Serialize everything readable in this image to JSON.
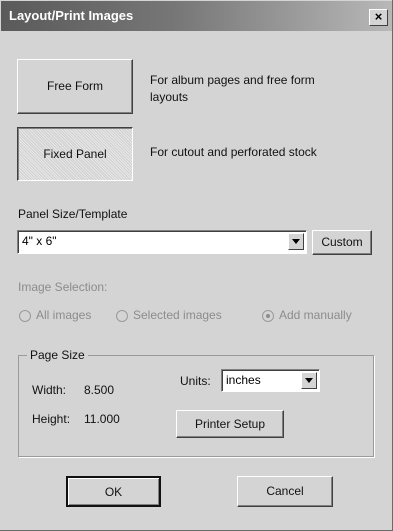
{
  "window": {
    "title": "Layout/Print Images",
    "close_glyph": "×"
  },
  "layout_options": [
    {
      "label": "Free Form",
      "description_lines": [
        "For album pages and free form",
        "layouts"
      ],
      "pressed": false
    },
    {
      "label": "Fixed Panel",
      "description_lines": [
        "For cutout and perforated stock"
      ],
      "pressed": true
    }
  ],
  "panel_size": {
    "label": "Panel Size/Template",
    "value": "4\" x 6\"",
    "custom_label": "Custom"
  },
  "image_selection": {
    "label": "Image Selection:",
    "options": [
      {
        "label": "All images",
        "checked": false,
        "enabled": false
      },
      {
        "label": "Selected images",
        "checked": false,
        "enabled": false
      },
      {
        "label": "Add manually",
        "checked": true,
        "enabled": false
      }
    ]
  },
  "page_size": {
    "title": "Page Size",
    "width_label": "Width:",
    "width_value": "8.500",
    "height_label": "Height:",
    "height_value": "11.000",
    "units_label": "Units:",
    "units_value": "inches",
    "printer_setup_label": "Printer Setup"
  },
  "footer": {
    "ok_label": "OK",
    "cancel_label": "Cancel"
  }
}
